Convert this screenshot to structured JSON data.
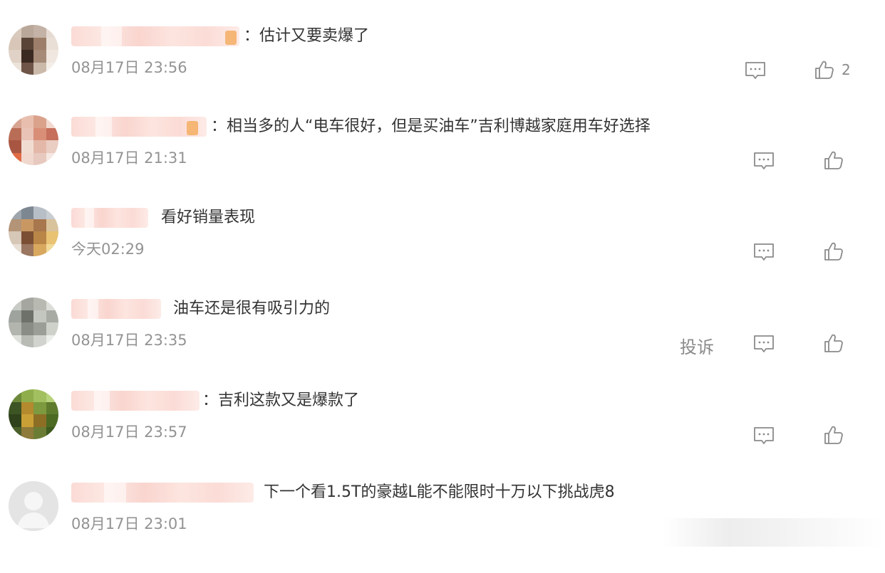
{
  "comments": [
    {
      "text": "：估计又要卖爆了",
      "time": "08月17日 23:56",
      "like_count": "2"
    },
    {
      "text": "：相当多的人“电车很好，但是买油车”吉利博越家庭用车好选择",
      "time": "08月17日 21:31"
    },
    {
      "text": "看好销量表现",
      "time": "今天02:29"
    },
    {
      "text": "油车还是很有吸引力的",
      "time": "08月17日 23:35",
      "report_label": "投诉"
    },
    {
      "text": "：吉利这款又是爆款了",
      "time": "08月17日 23:57"
    },
    {
      "text": "下一个看1.5T的豪越L能不能限时十万以下挑战虎8",
      "time": "08月17日 23:01"
    }
  ],
  "icons": {
    "reply": "comment-icon",
    "like": "thumbs-up-icon"
  },
  "colors": {
    "text": "#333333",
    "time": "#939393",
    "icon": "#8a8a8a"
  }
}
